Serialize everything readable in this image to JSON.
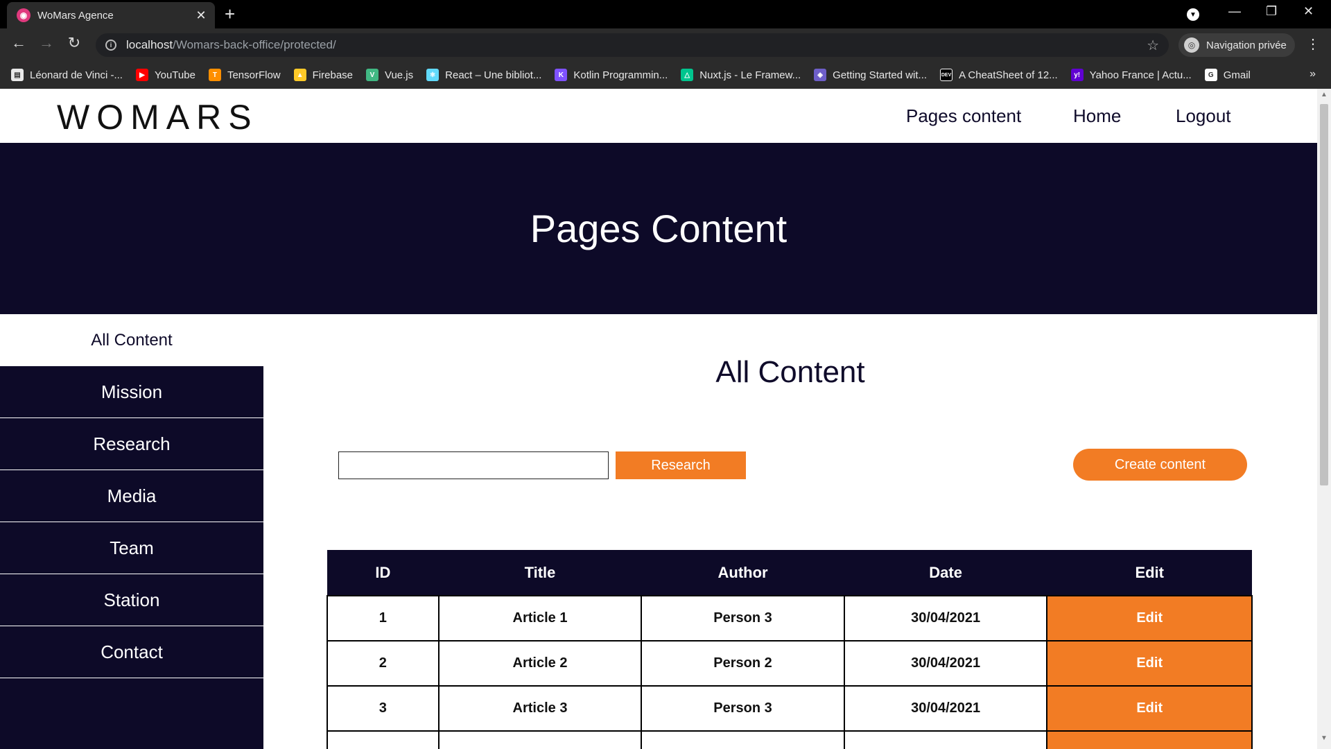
{
  "browser": {
    "tab_title": "WoMars Agence",
    "favicon": "womars-favicon",
    "url_host": "localhost",
    "url_path": "/Womars-back-office/protected/",
    "incognito_label": "Navigation privée",
    "bookmarks": [
      {
        "label": "Léonard de Vinci -...",
        "icon": "ldv-icon",
        "color": "#e8e8e8"
      },
      {
        "label": "YouTube",
        "icon": "youtube-icon",
        "color": "#ff0000"
      },
      {
        "label": "TensorFlow",
        "icon": "tensorflow-icon",
        "color": "#ff8f00"
      },
      {
        "label": "Firebase",
        "icon": "firebase-icon",
        "color": "#ffca28"
      },
      {
        "label": "Vue.js",
        "icon": "vuejs-icon",
        "color": "#41b883"
      },
      {
        "label": "React – Une bibliot...",
        "icon": "react-icon",
        "color": "#61dafb"
      },
      {
        "label": "Kotlin Programmin...",
        "icon": "kotlin-icon",
        "color": "#7f52ff"
      },
      {
        "label": "Nuxt.js - Le Framew...",
        "icon": "nuxt-icon",
        "color": "#00c58e"
      },
      {
        "label": "Getting Started wit...",
        "icon": "apollo-icon",
        "color": "#6e5fc9"
      },
      {
        "label": "A CheatSheet of 12...",
        "icon": "dev-icon",
        "color": "#000000"
      },
      {
        "label": "Yahoo France | Actu...",
        "icon": "yahoo-icon",
        "color": "#6001d2"
      },
      {
        "label": "Gmail",
        "icon": "google-icon",
        "color": "#ffffff"
      }
    ]
  },
  "site": {
    "logo": "WOMARS",
    "nav": [
      "Pages content",
      "Home",
      "Logout"
    ],
    "hero_title": "Pages Content",
    "sidebar": {
      "active": "All Content",
      "items": [
        "Mission",
        "Research",
        "Media",
        "Team",
        "Station",
        "Contact"
      ]
    },
    "main_title": "All Content",
    "search": {
      "value": "",
      "button_label": "Research"
    },
    "create_label": "Create content",
    "table": {
      "headers": [
        "ID",
        "Title",
        "Author",
        "Date",
        "Edit"
      ],
      "rows": [
        {
          "id": "1",
          "title": "Article 1",
          "author": "Person 3",
          "date": "30/04/2021",
          "edit": "Edit"
        },
        {
          "id": "2",
          "title": "Article 2",
          "author": "Person 2",
          "date": "30/04/2021",
          "edit": "Edit"
        },
        {
          "id": "3",
          "title": "Article 3",
          "author": "Person 3",
          "date": "30/04/2021",
          "edit": "Edit"
        },
        {
          "id": "",
          "title": "",
          "author": "",
          "date": "",
          "edit": ""
        }
      ]
    },
    "colors": {
      "navy": "#0d0a28",
      "accent": "#f27c24"
    }
  }
}
